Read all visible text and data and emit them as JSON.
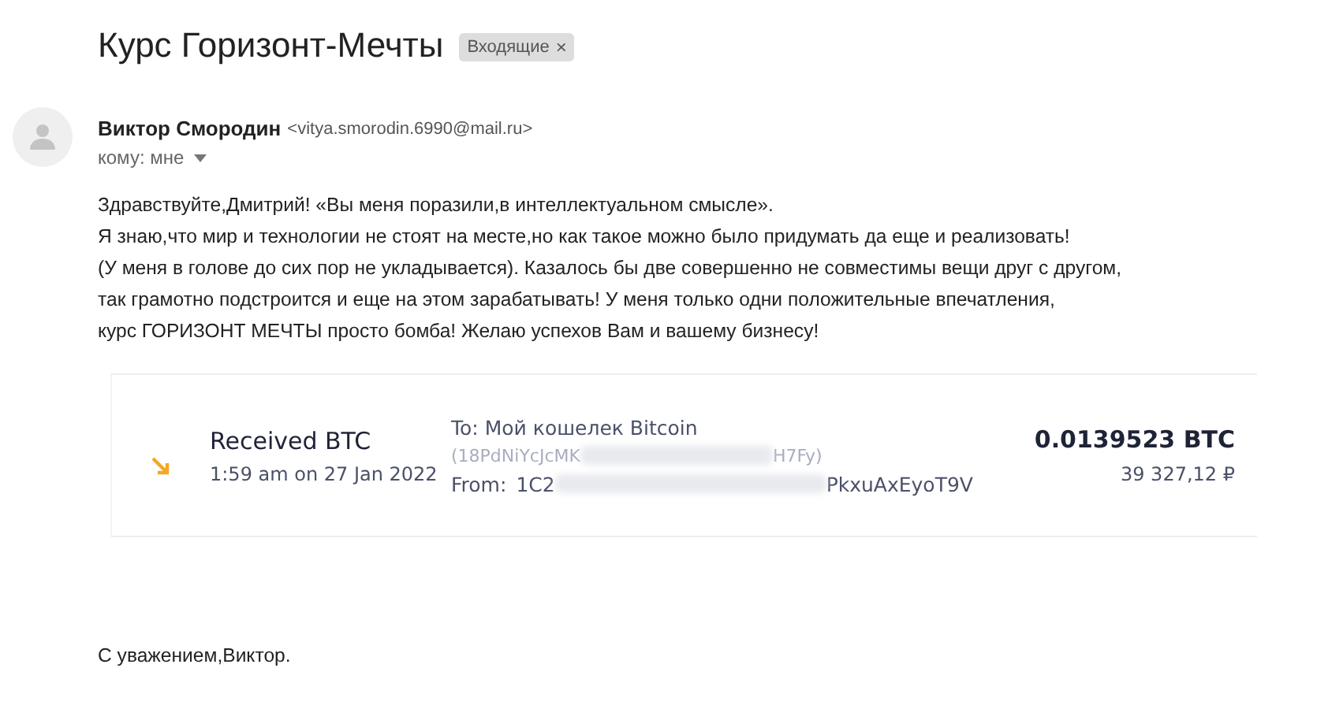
{
  "subject": "Курс Горизонт-Мечты",
  "label": {
    "text": "Входящие",
    "close": "×"
  },
  "sender": {
    "name": "Виктор Смородин",
    "email": "<vitya.smorodin.6990@mail.ru>",
    "to": "кому: мне"
  },
  "body": [
    "Здравствуйте,Дмитрий! «Вы меня поразили,в интеллектуальном смысле».",
    "Я знаю,что мир и технологии не стоят на месте,но как такое можно было придумать да еще и реализовать!",
    "(У меня в голове до сих пор не укладывается). Казалось бы две совершенно не совместимы вещи друг с другом,",
    "так грамотно подстроится и еще на этом зарабатывать! У меня только одни положительные впечатления,",
    "курс ГОРИЗОНТ МЕЧТЫ просто бомба! Желаю успехов Вам и вашему бизнесу!"
  ],
  "transaction": {
    "title": "Received BTC",
    "time": "1:59 am on 27 Jan 2022",
    "to_label": "To:",
    "to_wallet": "Мой кошелек Bitcoin",
    "address_start": "(18PdNiYcJcMK",
    "address_end": "H7Fy)",
    "from_label": "From:",
    "from_start": "1C2",
    "from_end": "PkxuAxEyoT9V",
    "amount": "0.0139523 BTC",
    "fiat": "39 327,12 ₽"
  },
  "signature": "С уважением,Виктор."
}
